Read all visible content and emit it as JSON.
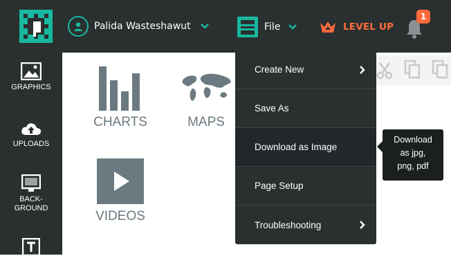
{
  "header": {
    "user_name": "Palida Wasteshawut",
    "file_label": "File",
    "levelup_label": "LEVEL UP",
    "notification_count": "1"
  },
  "sidebar": {
    "items": [
      {
        "label": "GRAPHICS",
        "icon": "image-icon"
      },
      {
        "label": "UPLOADS",
        "icon": "cloud-upload-icon"
      },
      {
        "label": "BACK-\nGROUND",
        "icon": "background-icon"
      },
      {
        "label": "",
        "icon": "text-icon"
      }
    ]
  },
  "content": {
    "tiles": [
      {
        "label": "CHARTS",
        "icon": "bar-chart-icon"
      },
      {
        "label": "MAPS",
        "icon": "world-map-icon"
      },
      {
        "label": "VIDEOS",
        "icon": "play-icon"
      }
    ]
  },
  "file_menu": {
    "items": [
      {
        "label": "Create New",
        "has_submenu": true
      },
      {
        "label": "Save As",
        "has_submenu": false
      },
      {
        "label": "Download as Image",
        "has_submenu": false,
        "hovered": true
      },
      {
        "label": "Page Setup",
        "has_submenu": false
      },
      {
        "label": "Troubleshooting",
        "has_submenu": true
      }
    ]
  },
  "tooltip": {
    "lines": [
      "Download",
      "as jpg,",
      "png, pdf"
    ]
  },
  "colors": {
    "bar_bg": "#29302f",
    "accent_teal": "#19b8a0",
    "levelup_orange": "#ff6a3d",
    "tile_gray": "#6b7a80"
  }
}
